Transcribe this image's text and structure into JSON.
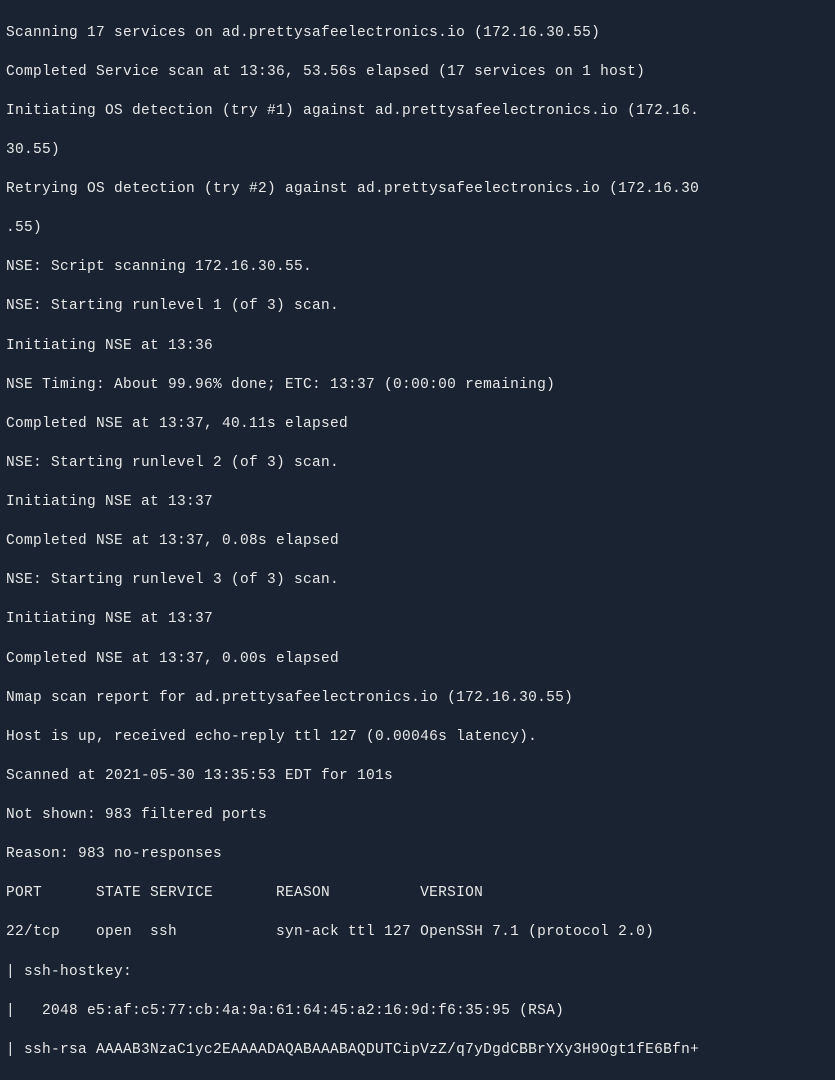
{
  "lines": {
    "l0": "Scanning 17 services on ad.prettysafeelectronics.io (172.16.30.55)",
    "l1": "Completed Service scan at 13:36, 53.56s elapsed (17 services on 1 host)",
    "l2": "Initiating OS detection (try #1) against ad.prettysafeelectronics.io (172.16.",
    "l3": "30.55)",
    "l4": "Retrying OS detection (try #2) against ad.prettysafeelectronics.io (172.16.30",
    "l5": ".55)",
    "l6": "NSE: Script scanning 172.16.30.55.",
    "l7": "NSE: Starting runlevel 1 (of 3) scan.",
    "l8": "Initiating NSE at 13:36",
    "l9": "NSE Timing: About 99.96% done; ETC: 13:37 (0:00:00 remaining)",
    "l10": "Completed NSE at 13:37, 40.11s elapsed",
    "l11": "NSE: Starting runlevel 2 (of 3) scan.",
    "l12": "Initiating NSE at 13:37",
    "l13": "Completed NSE at 13:37, 0.08s elapsed",
    "l14": "NSE: Starting runlevel 3 (of 3) scan.",
    "l15": "Initiating NSE at 13:37",
    "l16": "Completed NSE at 13:37, 0.00s elapsed",
    "l17": "Nmap scan report for ad.prettysafeelectronics.io (172.16.30.55)",
    "l18": "Host is up, received echo-reply ttl 127 (0.00046s latency).",
    "l19": "Scanned at 2021-05-30 13:35:53 EDT for 101s",
    "l20": "Not shown: 983 filtered ports",
    "l21": "Reason: 983 no-responses",
    "l22": "PORT      STATE SERVICE       REASON          VERSION",
    "l23": "22/tcp    open  ssh           syn-ack ttl 127 OpenSSH 7.1 (protocol 2.0)",
    "l24": "| ssh-hostkey:",
    "l25": "|   2048 e5:af:c5:77:cb:4a:9a:61:64:45:a2:16:9d:f6:35:95 (RSA)",
    "l26": "| ssh-rsa AAAAB3NzaC1yc2EAAAADAQABAAABAQDUTCipVzZ/q7yDgdCBBrYXy3H9Ogt1fE6Bfn+"
  }
}
